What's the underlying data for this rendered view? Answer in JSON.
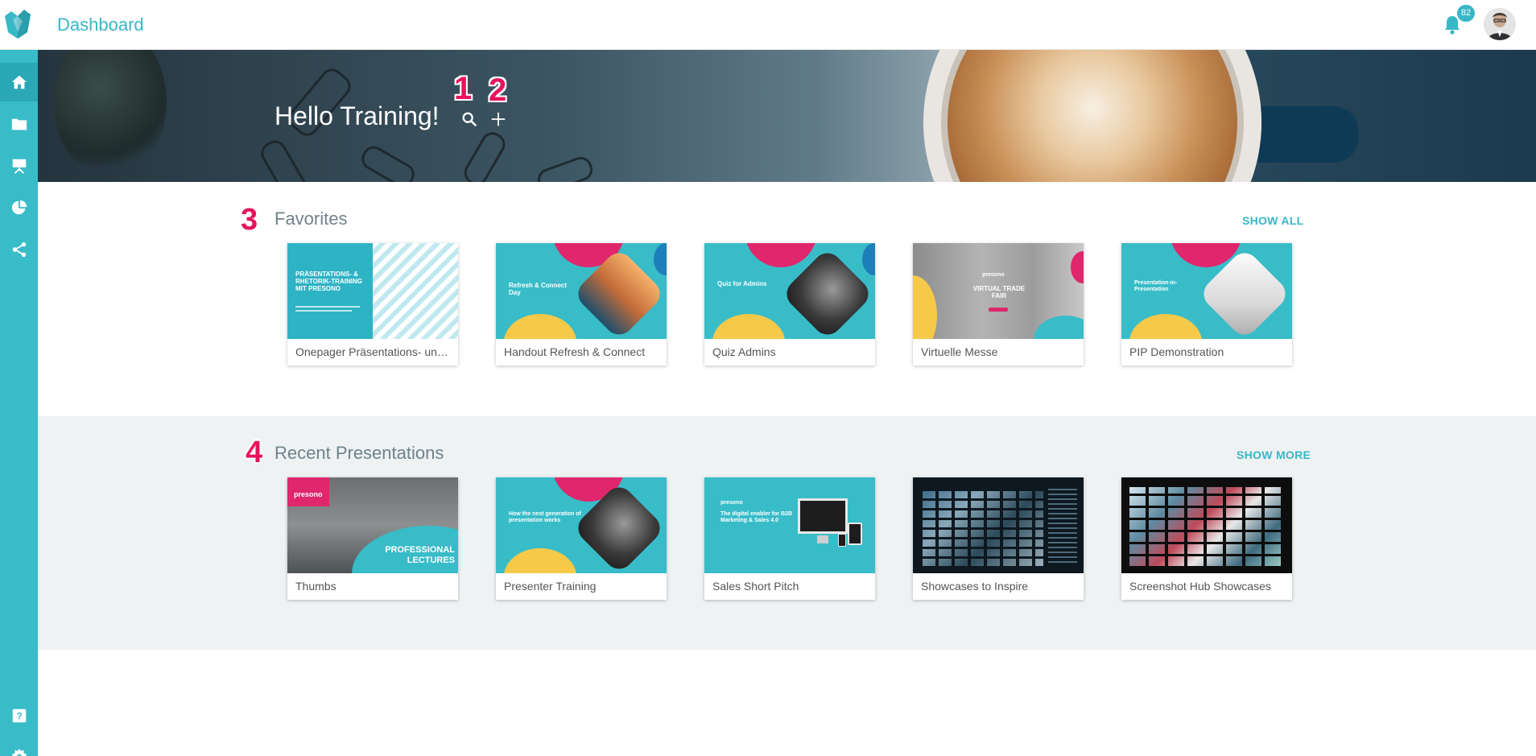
{
  "header": {
    "title": "Dashboard",
    "notification_count": "82"
  },
  "hero": {
    "greeting": "Hello Training!",
    "markers": [
      "1",
      "2"
    ]
  },
  "favorites": {
    "title": "Favorites",
    "marker": "3",
    "link_label": "SHOW ALL",
    "cards": [
      {
        "label": "Onepager Präsentations- und Rhetoriktraining",
        "thumb_title": "PRÄSENTATIONS- & RHETORIK-TRAINING MIT PRESONO"
      },
      {
        "label": "Handout Refresh & Connect",
        "thumb_title": "Refresh & Connect Day"
      },
      {
        "label": "Quiz Admins",
        "thumb_title": "Quiz for Admins"
      },
      {
        "label": "Virtuelle Messe",
        "thumb_title": "VIRTUAL TRADE FAIR",
        "thumb_brand": "presono"
      },
      {
        "label": "PIP Demonstration",
        "thumb_title": "Presentation-in-Presentation"
      }
    ]
  },
  "recent": {
    "title": "Recent Presentations",
    "marker": "4",
    "link_label": "SHOW MORE",
    "cards": [
      {
        "label": "Thumbs",
        "thumb_title": "PROFESSIONAL LECTURES",
        "thumb_brand": "presono"
      },
      {
        "label": "Presenter Training",
        "thumb_title": "How the next generation of presentation works"
      },
      {
        "label": "Sales Short Pitch",
        "thumb_title": "The digital enabler for B2B Marketing & Sales 4.0",
        "thumb_brand": "presono"
      },
      {
        "label": "Showcases to Inspire"
      },
      {
        "label": "Screenshot Hub Showcases"
      }
    ]
  },
  "colors": {
    "accent": "#38b7c7",
    "sidebar": "#38bcc8",
    "marker": "#e8135d",
    "recent_bg": "#eef2f3"
  },
  "icons": {
    "sidebar": [
      "home-icon",
      "folder-icon",
      "presentation-icon",
      "pie-chart-icon",
      "share-icon",
      "help-icon",
      "settings-icon"
    ],
    "hero": [
      "search-icon",
      "plus-icon"
    ],
    "header": [
      "bell-icon"
    ]
  }
}
